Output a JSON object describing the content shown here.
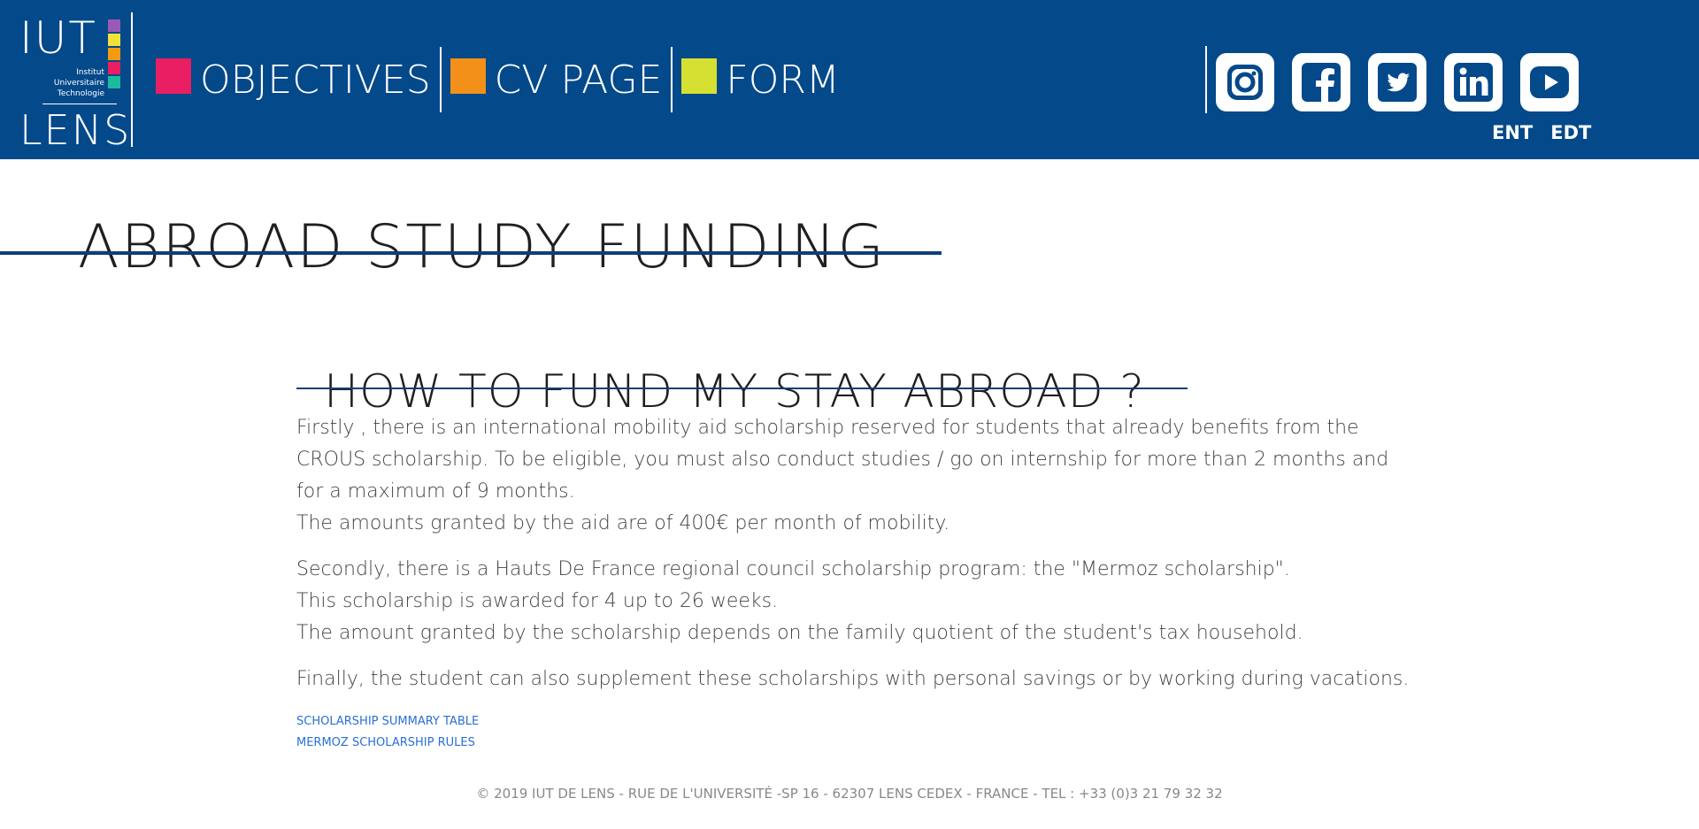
{
  "logo": {
    "top": "IUT",
    "subtitle_lines": [
      "Institut",
      "Universitaire",
      "Technologie"
    ],
    "bottom": "LENS",
    "square_colors": [
      "#9b59b6",
      "#f1e23a",
      "#f39c12",
      "#e91e63",
      "#1abc9c"
    ]
  },
  "nav": {
    "items": [
      {
        "label": "OBJECTIVES",
        "color": "#e91e63"
      },
      {
        "label": "CV PAGE",
        "color": "#f39019"
      },
      {
        "label": "FORM",
        "color": "#d5e032"
      }
    ]
  },
  "social": {
    "icons": [
      "instagram-icon",
      "facebook-icon",
      "twitter-icon",
      "linkedin-icon",
      "youtube-icon"
    ],
    "links": [
      "ENT",
      "EDT"
    ]
  },
  "page": {
    "title": "ABROAD STUDY FUNDING",
    "subtitle": "HOW TO FUND MY STAY ABROAD ?",
    "paragraphs": [
      [
        "Firstly , there is an international mobility aid scholarship reserved for students that already benefits from the CROUS scholarship. To be eligible, you must also conduct studies / go on internship for more than 2 months and for a maximum of 9 months.",
        "The amounts granted by the aid are of 400€ per month of mobility."
      ],
      [
        "Secondly, there is a Hauts De France regional council scholarship program: the \"Mermoz scholarship\".",
        "This scholarship is awarded for 4 up to 26 weeks.",
        "The amount granted by the scholarship depends on the family quotient of the student's tax household."
      ],
      [
        "Finally, the student can also supplement these scholarships with personal savings or by working during vacations."
      ]
    ],
    "links": [
      "SCHOLARSHIP SUMMARY TABLE",
      "MERMOZ SCHOLARSHIP RULES"
    ]
  },
  "footer": {
    "text": "© 2019 IUT DE LENS - RUE DE L'UNIVERSITÉ -SP 16 - 62307 LENS CEDEX - FRANCE - TEL : +33 (0)3 21 79 32 32"
  }
}
